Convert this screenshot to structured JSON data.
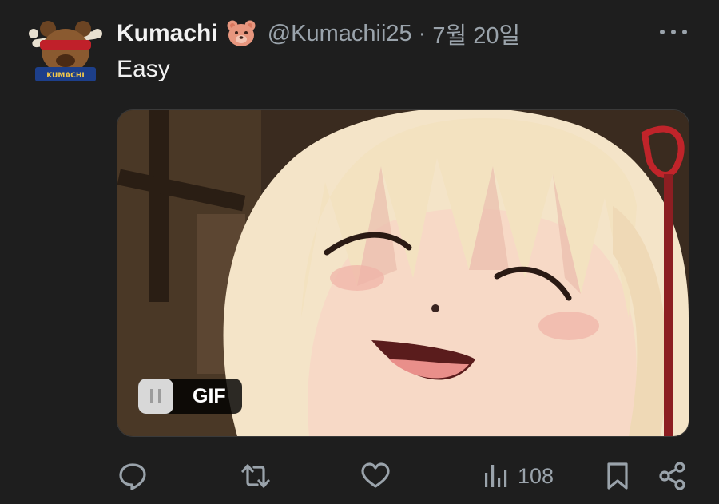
{
  "tweet": {
    "author_name": "Kumachi",
    "author_badge": "bear-face-emoji",
    "handle": "@Kumachii25",
    "separator": "·",
    "date": "7월 20일",
    "text": "Easy",
    "avatar_label": "KUMACHI"
  },
  "media": {
    "type": "gif",
    "badge_label": "GIF",
    "pause_icon": "pause-icon"
  },
  "actions": {
    "reply_icon": "reply-icon",
    "retweet_icon": "retweet-icon",
    "like_icon": "heart-icon",
    "views_icon": "views-icon",
    "views_count": "108",
    "bookmark_icon": "bookmark-icon",
    "share_icon": "share-icon"
  },
  "colors": {
    "background": "#1e1e1e",
    "text_primary": "#e7e9ea",
    "text_secondary": "#9aa3ab"
  }
}
